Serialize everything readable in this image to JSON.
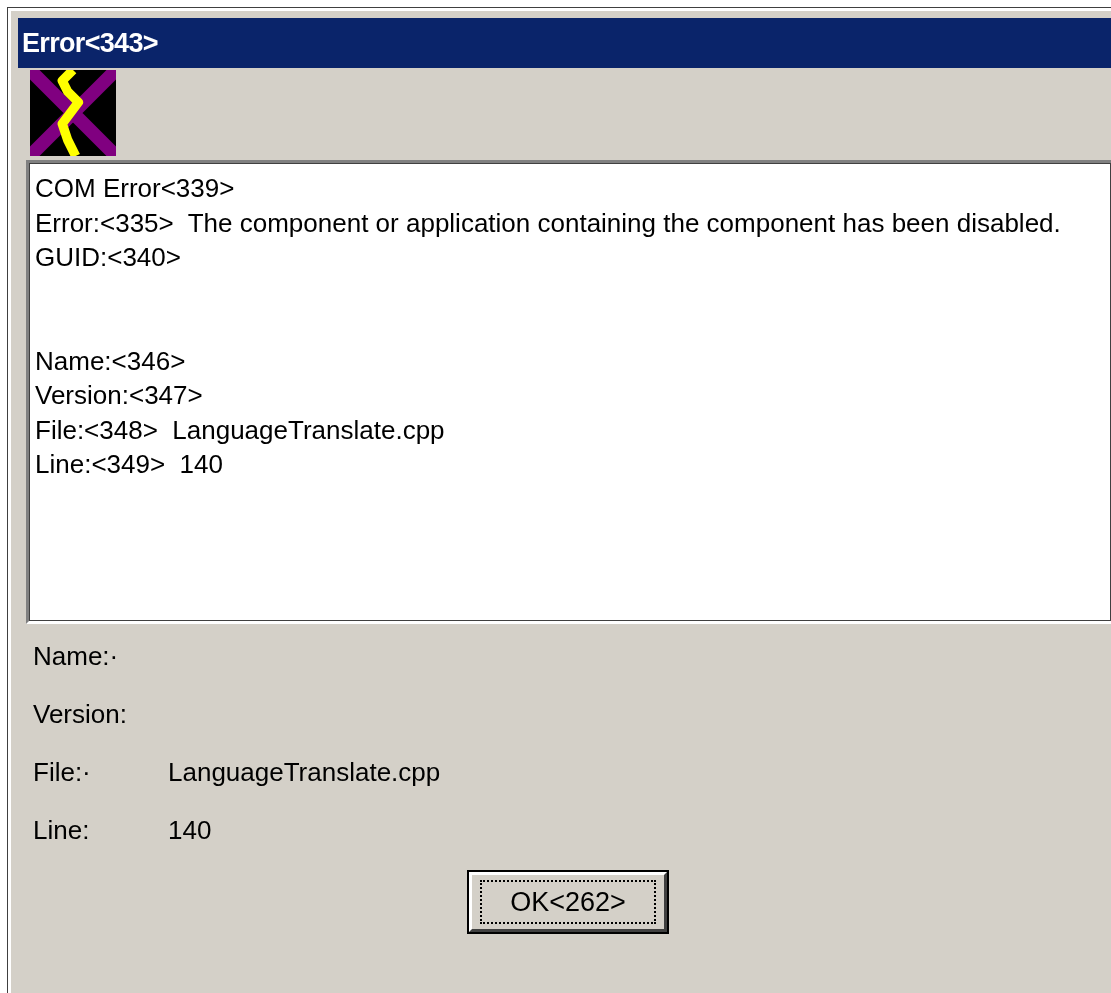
{
  "window": {
    "title": "Error<343>"
  },
  "message": {
    "error_lines": [
      "COM Error<339>",
      "Error:<335>  The component or application containing the component has been disabled.",
      "GUID:<340>"
    ],
    "detail_lines": [
      "Name:<346>",
      "Version:<347>",
      "File:<348>  LanguageTranslate.cpp",
      "Line:<349>  140"
    ]
  },
  "fields": [
    {
      "label": "Name:·"
    },
    {
      "label": "Version:"
    },
    {
      "label": "File:·",
      "value": "LanguageTranslate.cpp"
    },
    {
      "label": "Line:",
      "value": "140"
    }
  ],
  "buttons": [
    {
      "label": "OK<262>"
    }
  ]
}
